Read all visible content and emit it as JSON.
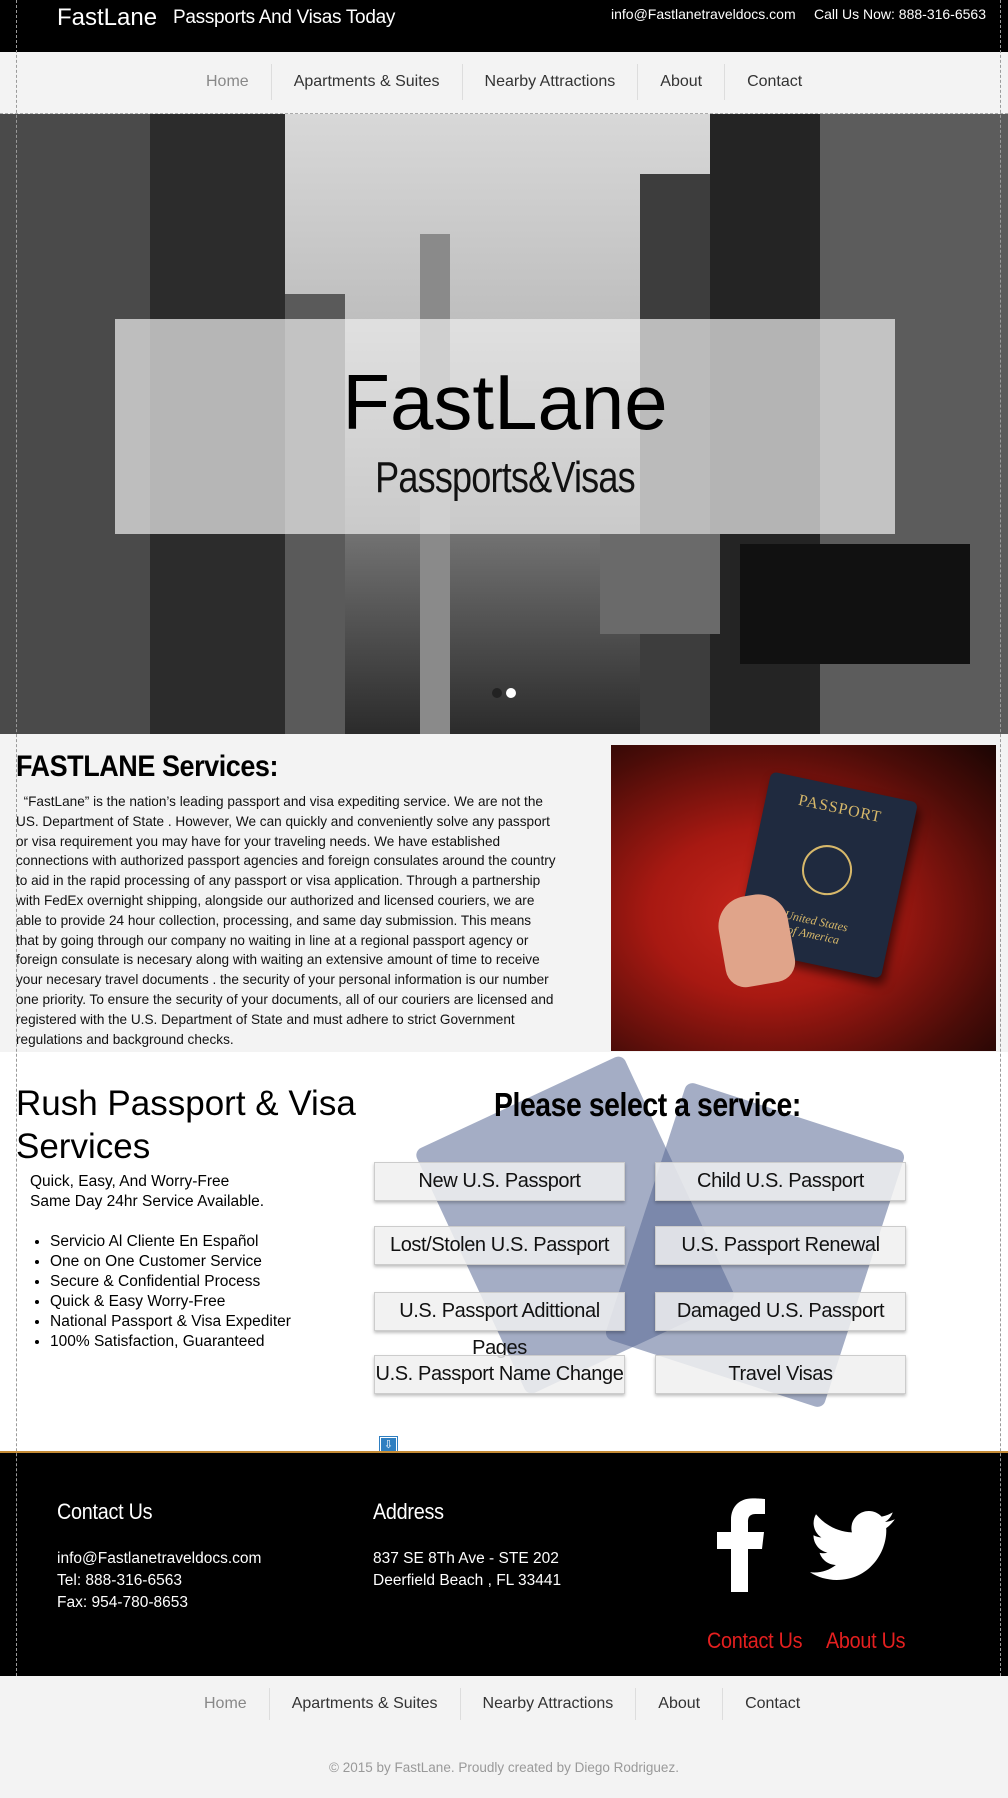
{
  "header": {
    "brand": "FastLane",
    "tagline": "Passports And Visas Today",
    "email": "info@Fastlanetraveldocs.com",
    "phone": "Call Us Now: 888-316-6563"
  },
  "nav": {
    "items": [
      "Home",
      "Apartments & Suites",
      "Nearby Attractions",
      "About",
      "Contact"
    ]
  },
  "hero": {
    "title": "FastLane",
    "subtitle": "Passports&Visas",
    "slides": 2,
    "active_slide": 2
  },
  "services": {
    "title": "FASTLANE Services:",
    "body": "  “FastLane” is the nation’s leading passport and visa expediting service. We are not the US. Department of State . However, We can quickly and conveniently solve any passport or visa requirement you may have for your traveling needs. We have established connections with authorized passport agencies and foreign consulates around the country to aid in the rapid processing of any passport or visa application. Through a partnership with FedEx overnight shipping, alongside our authorized and licensed couriers, we are able to provide 24 hour collection, processing, and same day submission. This means that by going through our company no waiting in line at a regional passport agency or foreign consulate is necesary along with waiting an extensive amount of time to receive your necesary travel documents . the security of your personal information is our number one priority. To ensure the security of your documents, all of our couriers are licensed and registered with the U.S. Department of State and must adhere to strict Government regulations and background checks.",
    "photo": {
      "passport_word": "PASSPORT",
      "passport_country_line1": "United States",
      "passport_country_line2": "of America"
    }
  },
  "rush": {
    "title": "Rush Passport & Visa Services",
    "sub_line1": "Quick, Easy, And Worry-Free",
    "sub_line2": "Same Day 24hr Service Available.",
    "list": [
      "Servicio Al Cliente En Español",
      "One on One Customer Service",
      "Secure & Confidential Process",
      "Quick & Easy Worry-Free",
      "National Passport & Visa Expediter",
      "100% Satisfaction, Guaranteed"
    ]
  },
  "select": {
    "title": "Please select a service:",
    "buttons": [
      "New U.S. Passport",
      "Child U.S. Passport",
      "Lost/Stolen U.S. Passport",
      "U.S. Passport Renewal",
      "U.S. Passport Adittional Pages",
      "Damaged U.S. Passport",
      "U.S. Passport Name Change",
      "Travel Visas"
    ]
  },
  "footer": {
    "contact_heading": "Contact Us",
    "contact_email": "info@Fastlanetraveldocs.com",
    "contact_tel": "Tel: 888-316-6563",
    "contact_fax": "Fax: 954-780-8653",
    "address_heading": "Address",
    "address_line1": "837 SE 8Th Ave - STE 202",
    "address_line2": "Deerfield Beach , FL 33441",
    "link_contact": "Contact Us",
    "link_about": "About Us",
    "social": [
      "facebook-icon",
      "twitter-icon"
    ],
    "link_color": "#e41f1f"
  },
  "bottom_nav": {
    "items": [
      "Home",
      "Apartments & Suites",
      "Nearby Attractions",
      "About",
      "Contact"
    ]
  },
  "copyright": "© 2015 by FastLane. Proudly created by Diego Rodriguez."
}
